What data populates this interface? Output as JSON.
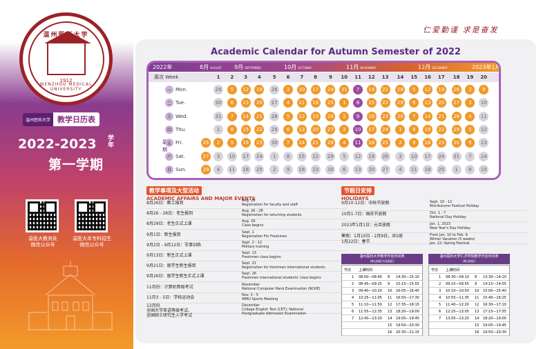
{
  "brand": {
    "motto": "仁爱勤谨  求是奋发",
    "seal_cn": "温州医科大学",
    "seal_en": "WENZHOU MEDICAL UNIVERSITY",
    "seal_year": "1912",
    "tag_small": "温州医科大学",
    "tag_big": "教学日历表",
    "year": "2022-2023",
    "year_suffix": "学年",
    "term": "第一学期",
    "qr1": "温医大教务处\n微信公众号",
    "qr2": "温医大本专科招生\n微信公众号"
  },
  "title": "Academic Calendar for Autumn Semester of 2022",
  "months": [
    {
      "label": "2022年",
      "en": ""
    },
    {
      "label": "8月",
      "en": "AUGUST"
    },
    {
      "label": "9月",
      "en": "SEPTEMBER"
    },
    {
      "label": "10月",
      "en": "OCTOBER"
    },
    {
      "label": "11月",
      "en": "NOVEMBER"
    },
    {
      "label": "12月",
      "en": "DECEMBER"
    },
    {
      "label": "2023年1月",
      "en": "JANUARY"
    }
  ],
  "week_label": "周次 Week",
  "weeks": [
    "1",
    "2",
    "3",
    "4",
    "5",
    "6",
    "7",
    "8",
    "9",
    "10",
    "11",
    "12",
    "13",
    "14",
    "15",
    "16",
    "17",
    "18",
    "19",
    "20"
  ],
  "days": [
    {
      "zh": "一",
      "en": "Mon."
    },
    {
      "zh": "二",
      "en": "Tue."
    },
    {
      "zh": "三",
      "en": "Wed."
    },
    {
      "zh": "四",
      "en": "Thu."
    },
    {
      "zh": "五",
      "en": "Fri."
    },
    {
      "zh": "六",
      "en": "Sat."
    },
    {
      "zh": "日",
      "en": "Sun."
    }
  ],
  "side_label": "星期",
  "grid": [
    [
      "",
      "29",
      "5",
      "12",
      "19",
      "26",
      "3",
      "10",
      "17",
      "24",
      "31",
      "7",
      "14",
      "21",
      "28",
      "5",
      "12",
      "19",
      "26",
      "2",
      "9"
    ],
    [
      "",
      "30",
      "6",
      "13",
      "20",
      "27",
      "4",
      "11",
      "18",
      "25",
      "1",
      "8",
      "15",
      "22",
      "29",
      "6",
      "13",
      "20",
      "27",
      "3",
      "10"
    ],
    [
      "",
      "31",
      "7",
      "14",
      "21",
      "28",
      "5",
      "12",
      "19",
      "26",
      "2",
      "9",
      "16",
      "23",
      "30",
      "7",
      "14",
      "21",
      "28",
      "4",
      "11"
    ],
    [
      "",
      "1",
      "8",
      "15",
      "22",
      "29",
      "6",
      "13",
      "20",
      "27",
      "3",
      "10",
      "17",
      "24",
      "1",
      "8",
      "15",
      "22",
      "29",
      "5",
      "12"
    ],
    [
      "26",
      "2",
      "9",
      "16",
      "23",
      "30",
      "7",
      "14",
      "21",
      "28",
      "4",
      "11",
      "18",
      "25",
      "2",
      "9",
      "16",
      "23",
      "30",
      "6",
      "13"
    ],
    [
      "27",
      "3",
      "10",
      "17",
      "24",
      "1",
      "8",
      "15",
      "22",
      "29",
      "5",
      "12",
      "19",
      "26",
      "3",
      "10",
      "17",
      "24",
      "31",
      "7",
      "14"
    ],
    [
      "28",
      "4",
      "11",
      "18",
      "25",
      "2",
      "9",
      "16",
      "23",
      "30",
      "6",
      "13",
      "20",
      "27",
      "4",
      "11",
      "18",
      "25",
      "1",
      "8",
      "15"
    ]
  ],
  "affairs": {
    "zh": "教学事项及大型活动",
    "en": "ACADEMIC AFFAIRS AND MAJOR EVENTS",
    "items": [
      {
        "zh": "8月26日：教工报到",
        "date": "Aug. 26",
        "en": "Registration for faculty and staff"
      },
      {
        "zh": "8月26 - 28日：老生报到",
        "date": "Aug. 26 - 28",
        "en": "Registration for returning students"
      },
      {
        "zh": "8月29日：老生正式上课",
        "date": "Aug. 29",
        "en": "Class begins"
      },
      {
        "zh": "9月1日：新生报到",
        "date": "Sept. 1",
        "en": "Registration For Freshmen"
      },
      {
        "zh": "9月2日 - 9月12日：军事训练",
        "date": "Sept. 2 - 12",
        "en": "Military training"
      },
      {
        "zh": "9月13日：新生正式上课",
        "date": "Sept. 13",
        "en": "Freshmen class begins"
      },
      {
        "zh": "9月21日：留学生新生报到",
        "date": "Sept. 21",
        "en": "Registration for freshmen international students"
      },
      {
        "zh": "9月26日：留学生新生正式上课",
        "date": "Sept. 26",
        "en": "Freshmen international students' class begins"
      },
      {
        "zh": "11月份：计算机等级考试",
        "date": "November",
        "en": "National Computer Rank Examination (NCRE)"
      },
      {
        "zh": "11月3 - 5日：学校运动会",
        "date": "Nov. 3 - 5",
        "en": "WMU Sports Meeting"
      },
      {
        "zh": "12月份\n全国大学英语等级考试、\n全国硕士研究生入学考试",
        "date": "December",
        "en": "College English Test (CET); National\nPostgraduate Admission Examination"
      }
    ]
  },
  "holidays": {
    "zh": "节假日安排",
    "en": "HOLIDAYS",
    "items": [
      {
        "zh": "9月10-12日：中秋节放假",
        "date": "Sept. 10 - 12",
        "en": "Mid-Autumn Festival Holiday"
      },
      {
        "zh": "10月1-7日：国庆节放假",
        "date": "Oct. 1 - 7",
        "en": "National Day Holiday"
      },
      {
        "zh": "2023年1月1日：元旦放假",
        "date": "Jan. 1, 2023",
        "en": "New Year's Day Holiday"
      },
      {
        "zh": "寒假：1月10日 - 2月9日，共5周\n1月22日：春节",
        "date": "From Jan. 10 to Feb. 9",
        "en": "Winter Vacation (5 weeks)\nJan. 22: Spring Festival"
      }
    ]
  },
  "schedule1": {
    "title": "温州医科大学教学作息时间表",
    "sub": "(茶山校区与北校区)",
    "h1": "节次",
    "h2": "上课时间",
    "rows": [
      [
        "1",
        "08:00—08:40",
        "8",
        "14:30—15:10"
      ],
      [
        "2",
        "08:45—09:25",
        "9",
        "15:15—15:55"
      ],
      [
        "3",
        "09:40—10:20",
        "10",
        "16:05—16:45"
      ],
      [
        "4",
        "10:25—11:05",
        "11",
        "16:50—17:30"
      ],
      [
        "5",
        "11:10—11:50",
        "12",
        "17:35—18:15"
      ],
      [
        "6",
        "11:55—12:35",
        "13",
        "18:20—19:00"
      ],
      [
        "7",
        "12:40—13:20",
        "14",
        "19:05—19:45"
      ],
      [
        "",
        "",
        "15",
        "19:50—20:30"
      ],
      [
        "",
        "",
        "16",
        "20:35—21:15"
      ]
    ]
  },
  "schedule2": {
    "title": "温州医科大学仁济学院教学作息时间表",
    "sub": "(茶山校区)",
    "h1": "节次",
    "h2": "上课时间",
    "rows": [
      [
        "1",
        "08:30—09:10",
        "8",
        "13:30—14:10"
      ],
      [
        "2",
        "09:15—09:55",
        "9",
        "14:15—14:55"
      ],
      [
        "3",
        "10:10—10:50",
        "10",
        "15:00—15:40"
      ],
      [
        "4",
        "10:55—11:35",
        "11",
        "15:45—16:25"
      ],
      [
        "5",
        "11:40—12:20",
        "12",
        "16:30—17:10"
      ],
      [
        "6",
        "12:25—13:05",
        "13",
        "17:15—17:55"
      ],
      [
        "7",
        "13:05—13:20",
        "14",
        "18:20—19:00"
      ],
      [
        "",
        "",
        "15",
        "19:05—19:45"
      ],
      [
        "",
        "",
        "16",
        "19:50—20:30"
      ]
    ]
  },
  "colors": {
    "orange": "#f0992a",
    "purple": "#9a4c9f",
    "grey": "#d7d4dc"
  }
}
